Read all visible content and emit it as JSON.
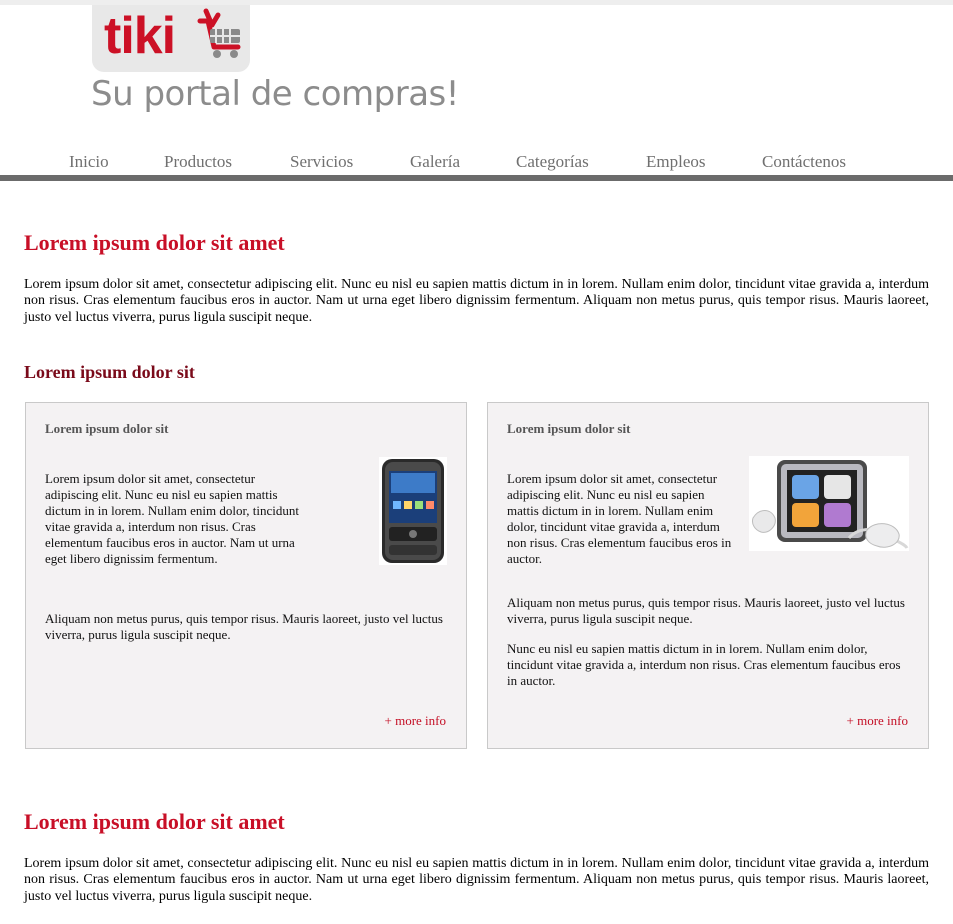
{
  "header": {
    "logo_text": "tiki",
    "tagline": "Su portal de compras!"
  },
  "nav": {
    "items": [
      "Inicio",
      "Productos",
      "Servicios",
      "Galería",
      "Categorías",
      "Empleos",
      "Contáctenos"
    ]
  },
  "section1": {
    "title": "Lorem ipsum dolor sit amet",
    "text": "Lorem ipsum dolor sit amet, consectetur adipiscing elit. Nunc eu nisl eu sapien mattis dictum in in lorem. Nullam enim dolor, tincidunt vitae gravida a, interdum non risus. Cras elementum faucibus eros in auctor. Nam ut urna eget libero dignissim fermentum. Aliquam non metus purus, quis tempor risus. Mauris laoreet, justo vel luctus viverra, purus ligula suscipit neque."
  },
  "subsection": {
    "title": "Lorem ipsum dolor sit"
  },
  "cards": [
    {
      "title": "Lorem ipsum dolor sit",
      "text1": "Lorem ipsum dolor sit amet, consectetur adipiscing elit. Nunc eu nisl eu sapien mattis dictum in in lorem. Nullam enim dolor, tincidunt vitae gravida a, interdum non risus. Cras elementum faucibus eros in auctor. Nam ut urna eget libero dignissim fermentum.",
      "text2": "Aliquam non metus purus, quis tempor risus. Mauris laoreet, justo vel luctus viverra, purus ligula suscipit neque.",
      "more": "+ more info",
      "image": "smartphone"
    },
    {
      "title": "Lorem ipsum dolor sit",
      "text1": "Lorem ipsum dolor sit amet, consectetur adipiscing elit. Nunc eu nisl eu sapien mattis dictum in in lorem. Nullam enim dolor, tincidunt vitae gravida a, interdum non risus. Cras elementum faucibus eros in auctor.",
      "text2": "Aliquam non metus purus, quis tempor risus. Mauris laoreet, justo vel luctus viverra, purus ligula suscipit neque.",
      "text3": "Nunc eu nisl eu sapien mattis dictum in in lorem. Nullam enim dolor, tincidunt vitae gravida a, interdum non risus. Cras elementum faucibus eros in auctor.",
      "more": "+ more info",
      "image": "ipod-nano-with-earphones"
    }
  ],
  "section2": {
    "title": "Lorem ipsum dolor sit amet",
    "text": "Lorem ipsum dolor sit amet, consectetur adipiscing elit. Nunc eu nisl eu sapien mattis dictum in in lorem. Nullam enim dolor, tincidunt vitae gravida a, interdum non risus. Cras elementum faucibus eros in auctor. Nam ut urna eget libero dignissim fermentum. Aliquam non metus purus, quis tempor risus. Mauris laoreet, justo vel luctus viverra, purus ligula suscipit neque."
  },
  "colors": {
    "brand_red": "#cc1126",
    "heading_red": "#c80f27",
    "subheading_red": "#7a0a1a",
    "nav_text": "#707070",
    "nav_bar": "#6b6b6b",
    "card_bg": "#f4f2f3"
  }
}
